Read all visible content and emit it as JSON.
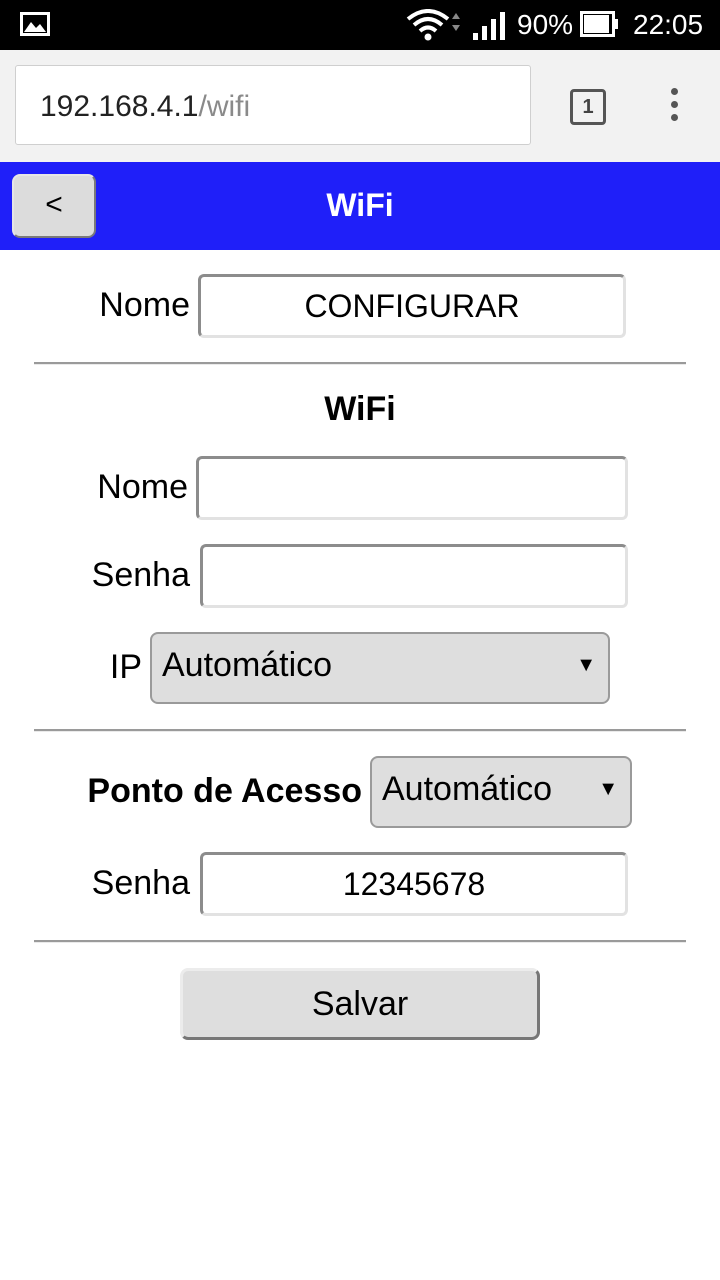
{
  "status_bar": {
    "battery_percent": "90%",
    "time": "22:05",
    "icons": [
      "gallery-icon",
      "wifi-icon",
      "signal-icon",
      "battery-icon"
    ]
  },
  "browser": {
    "url_host": "192.168.4.1",
    "url_path": "/wifi",
    "tab_count": "1",
    "icons": [
      "tabs-icon",
      "overflow-menu-icon"
    ]
  },
  "header": {
    "back_label": "<",
    "title": "WiFi",
    "color": "#1f1ff9"
  },
  "device": {
    "name_label": "Nome",
    "name_value": "CONFIGURAR"
  },
  "wifi": {
    "section_title": "WiFi",
    "ssid_label": "Nome",
    "ssid_value": "",
    "password_label": "Senha",
    "password_value": "",
    "ip_label": "IP",
    "ip_mode": "Automático"
  },
  "access_point": {
    "label": "Ponto de Acesso",
    "mode": "Automático",
    "password_label": "Senha",
    "password_value": "12345678"
  },
  "actions": {
    "save_label": "Salvar"
  }
}
